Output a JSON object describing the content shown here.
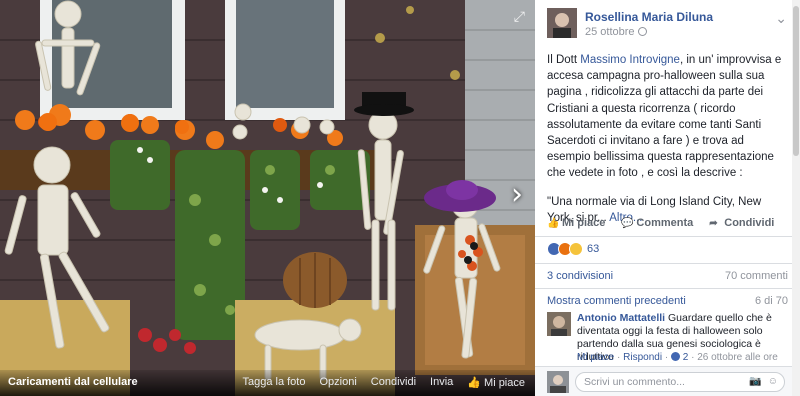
{
  "photo": {
    "album_title": "Caricamenti dal cellulare",
    "actions": [
      "Tagga la foto",
      "Opzioni",
      "Condividi",
      "Invia",
      "Mi piace"
    ]
  },
  "post": {
    "author": "Rosellina Maria Diluna",
    "date": "25 ottobre",
    "text_before_link": "Il Dott ",
    "mention": "Massimo Introvigne",
    "text_after_link": ", in un' improvvisa e accesa campagna pro-halloween sulla sua pagina , ridicolizza gli attacchi da parte dei Cristiani a questa ricorrenza ( ricordo assolutamente da evitare come tanti Santi Sacerdoti ci invitano a fare ) e trova ad esempio bellissima questa rappresentazione che vedete in foto , e così la descrive :",
    "quote_text": "\"Una normale via di Long Island City, New York, si pr...",
    "more_link": "Altro..."
  },
  "actions": {
    "like": "Mi piace",
    "comment": "Commenta",
    "share": "Condividi"
  },
  "reactions": {
    "count": "63",
    "colors": {
      "like": "#4267b2",
      "angry": "#e9710f",
      "haha": "#f5c33b"
    }
  },
  "stats": {
    "shares": "3 condivisioni",
    "comments": "70 commenti"
  },
  "comments_section": {
    "previous_link": "Mostra commenti precedenti",
    "page_count": "6 di 70",
    "items": [
      {
        "author": "Antonio Mattatelli",
        "text": " Guardare quello che è diventata oggi la festa di halloween solo partendo dalla sua genesi sociologica è riduttivo",
        "like_link": "Mi piace",
        "reply_link": "Rispondi",
        "likes": "2",
        "time": "26 ottobre alle ore"
      }
    ]
  },
  "composer": {
    "placeholder": "Scrivi un commento..."
  },
  "theme": {
    "link": "#365899",
    "meta": "#90949c",
    "text": "#1d2129"
  }
}
